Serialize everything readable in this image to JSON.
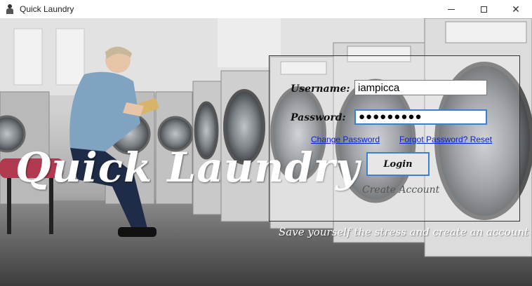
{
  "window": {
    "title": "Quick Laundry"
  },
  "branding": {
    "logo_text": "Quick Laundry",
    "tagline": "Save yourself  the stress and create an account"
  },
  "login_form": {
    "username_label": "Username:",
    "username_value": "iampicca",
    "password_label": "Password:",
    "password_value": "●●●●●●●●●",
    "change_password_link": "Change Password",
    "forgot_password_link": "Forgot Password? Reset",
    "login_button": "Login",
    "create_account_link": "Create Account"
  },
  "colors": {
    "link": "#0b1fd6",
    "focus_border": "#3c7fd6"
  }
}
